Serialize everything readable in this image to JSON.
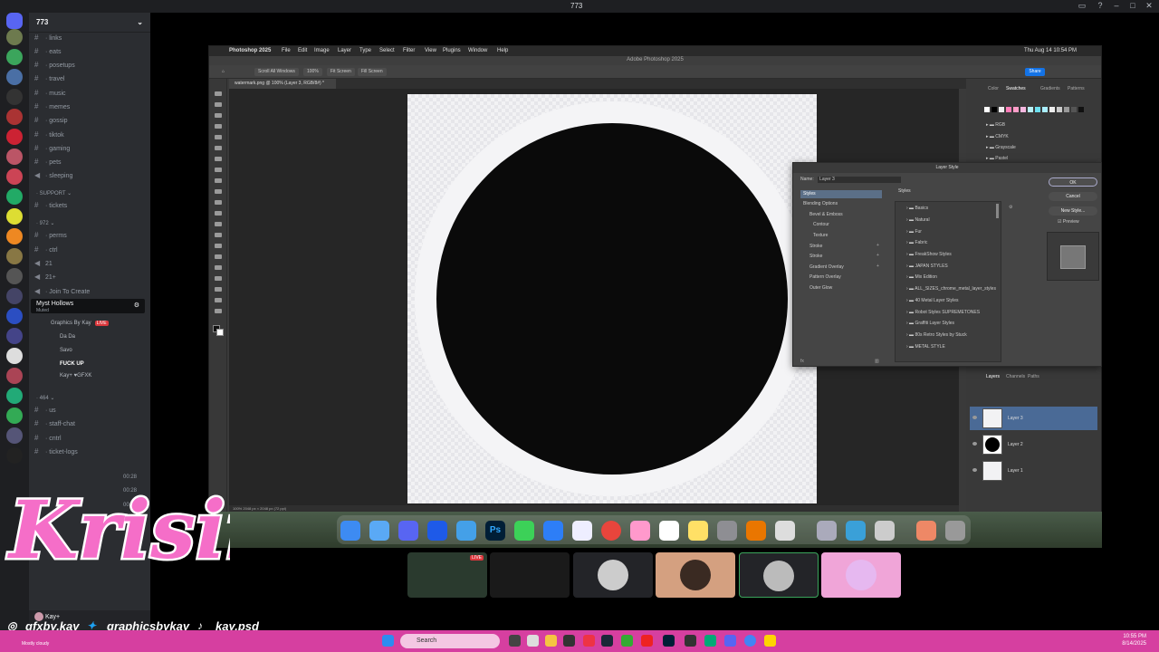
{
  "window": {
    "title": "773"
  },
  "server_name": "773",
  "channels": [
    {
      "name": "links"
    },
    {
      "name": "eats"
    },
    {
      "name": "posetups"
    },
    {
      "name": "travel"
    },
    {
      "name": "music"
    },
    {
      "name": "memes"
    },
    {
      "name": "gossip"
    },
    {
      "name": "tiktok"
    },
    {
      "name": "gaming"
    },
    {
      "name": "pets"
    },
    {
      "name": "sleeping"
    }
  ],
  "categories": {
    "support": "SUPPORT",
    "c972": "972",
    "c464": "464"
  },
  "support_channels": [
    {
      "name": "tickets"
    }
  ],
  "c972_channels": [
    {
      "name": "perms"
    },
    {
      "name": "ctrl"
    },
    {
      "name": "21"
    },
    {
      "name": "21+"
    }
  ],
  "join_to_create": "Join To Create",
  "voice_channel": {
    "name": "Myst Hollows",
    "tooltip_sub": "Muted"
  },
  "voice_users": [
    {
      "name": "Graphics By Kay",
      "live": "LIVE"
    },
    {
      "name": "Da Da"
    },
    {
      "name": "Savo"
    },
    {
      "name": "FUCK UP"
    },
    {
      "name": "Kay+ ♥GFXK"
    }
  ],
  "c464_channels": [
    {
      "name": "us"
    },
    {
      "name": "staff-chat"
    },
    {
      "name": "cntrl"
    },
    {
      "name": "ticket-logs"
    }
  ],
  "voice_timers": [
    "00:28",
    "00:28",
    "00:28"
  ],
  "user_panel": {
    "name": "Kay+"
  },
  "photoshop": {
    "menu": [
      "Photoshop 2025",
      "File",
      "Edit",
      "Image",
      "Layer",
      "Type",
      "Select",
      "Filter",
      "View",
      "Plugins",
      "Window",
      "Help"
    ],
    "clock": "Thu Aug 14  10:54 PM",
    "app_title": "Adobe Photoshop 2025",
    "options": [
      "Scroll All Windows",
      "100%",
      "Fit Screen",
      "Fill Screen"
    ],
    "share": "Share",
    "doc_tab": "watermark.png @ 100% (Layer 3, RGB/8#) *",
    "status": "100%    2048 px × 2048 px (72 ppi)",
    "panel_tabs_top": [
      "Color",
      "Swatches",
      "Gradients",
      "Patterns"
    ],
    "swatch_folders": [
      "RGB",
      "CMYK",
      "Grayscale",
      "Pastel"
    ],
    "panel_tabs_bottom": [
      "Layers",
      "Channels",
      "Paths"
    ],
    "layers": [
      {
        "name": "Layer 3"
      },
      {
        "name": "Layer 2"
      },
      {
        "name": "Layer 1"
      }
    ]
  },
  "dialog": {
    "title": "Layer Style",
    "name_label": "Name:",
    "name_value": "Layer 3",
    "left_items": [
      "Styles",
      "Blending Options",
      "Bevel & Emboss",
      "Contour",
      "Texture",
      "Stroke",
      "Stroke",
      "Gradient Overlay",
      "Pattern Overlay",
      "Outer Glow"
    ],
    "styles_header": "Styles",
    "style_folders": [
      "Basics",
      "Natural",
      "Fur",
      "Fabric",
      "FreakShow Styles",
      "JAPAN STYLES",
      "Mix Edition",
      "ALL_SIZES_chrome_metal_layer_styles",
      "40 Metal Layer Styles",
      "Robot Styles SUPREMETONES",
      "Graffiti Layer Styles",
      "80s Retro Styles by Stuck",
      "METAL STYLE"
    ],
    "ok": "OK",
    "cancel": "Cancel",
    "new_style": "New Style...",
    "preview": "Preview"
  },
  "overlay": {
    "logo_text": "Krisii",
    "instagram": "gfxby.kay",
    "twitter": "graphicsbykay",
    "tiktok": "kay.psd"
  },
  "taskbar": {
    "search": "Search",
    "time": "10:55 PM",
    "date": "8/14/2025",
    "weather": "Mostly cloudy"
  },
  "colors": {
    "taskbar": "#d63fa0",
    "discord_bg": "#2b2d31",
    "accent_live": "#da373c"
  }
}
